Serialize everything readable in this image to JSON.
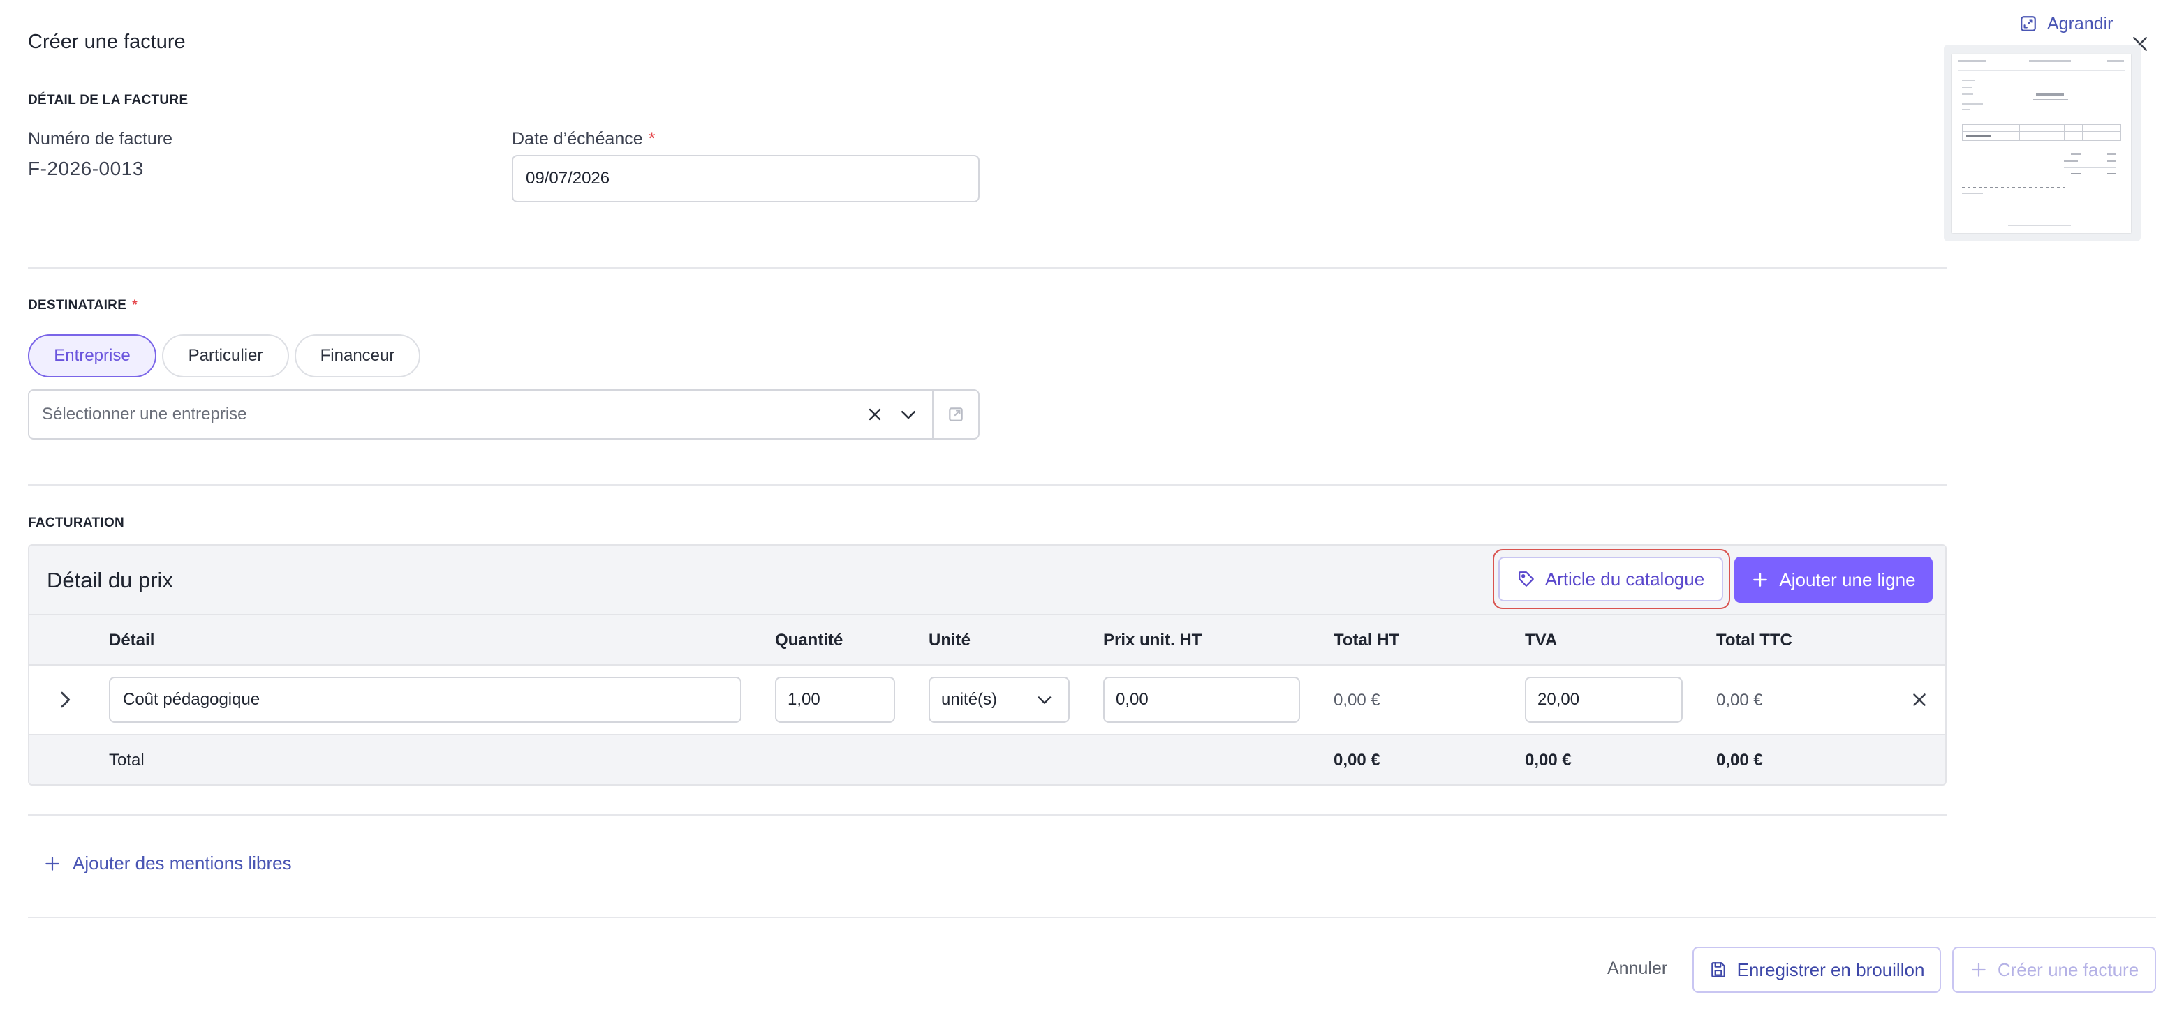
{
  "modal": {
    "title": "Créer une facture",
    "expand_label": "Agrandir"
  },
  "invoice_detail": {
    "section_label": "DÉTAIL DE LA FACTURE",
    "number_label": "Numéro de facture",
    "number_value": "F-2026-0013",
    "due_date_label": "Date d’échéance",
    "required_mark": "*",
    "due_date_value": "09/07/2026"
  },
  "recipient": {
    "section_label": "DESTINATAIRE",
    "required_mark": "*",
    "types": [
      "Entreprise",
      "Particulier",
      "Financeur"
    ],
    "active_type": "Entreprise",
    "select_placeholder": "Sélectionner une entreprise"
  },
  "billing": {
    "section_label": "FACTURATION",
    "price_detail_title": "Détail du prix",
    "catalog_button": "Article du catalogue",
    "add_line_button": "Ajouter une ligne",
    "columns": [
      "Détail",
      "Quantité",
      "Unité",
      "Prix unit. HT",
      "Total HT",
      "TVA",
      "Total TTC"
    ],
    "rows": [
      {
        "detail": "Coût pédagogique",
        "quantity": "1,00",
        "unit": "unité(s)",
        "unit_price": "0,00",
        "total_ht": "0,00 €",
        "tva": "20,00",
        "total_ttc": "0,00 €"
      }
    ],
    "total": {
      "label": "Total",
      "total_ht": "0,00 €",
      "tva": "0,00 €",
      "total_ttc": "0,00 €"
    }
  },
  "free_mentions_link": "Ajouter des mentions libres",
  "footer": {
    "cancel": "Annuler",
    "save_draft": "Enregistrer en brouillon",
    "create": "Créer une facture"
  },
  "colors": {
    "accent": "#7b61ff",
    "highlight_ring": "#d9534f",
    "required": "#e5484d"
  }
}
